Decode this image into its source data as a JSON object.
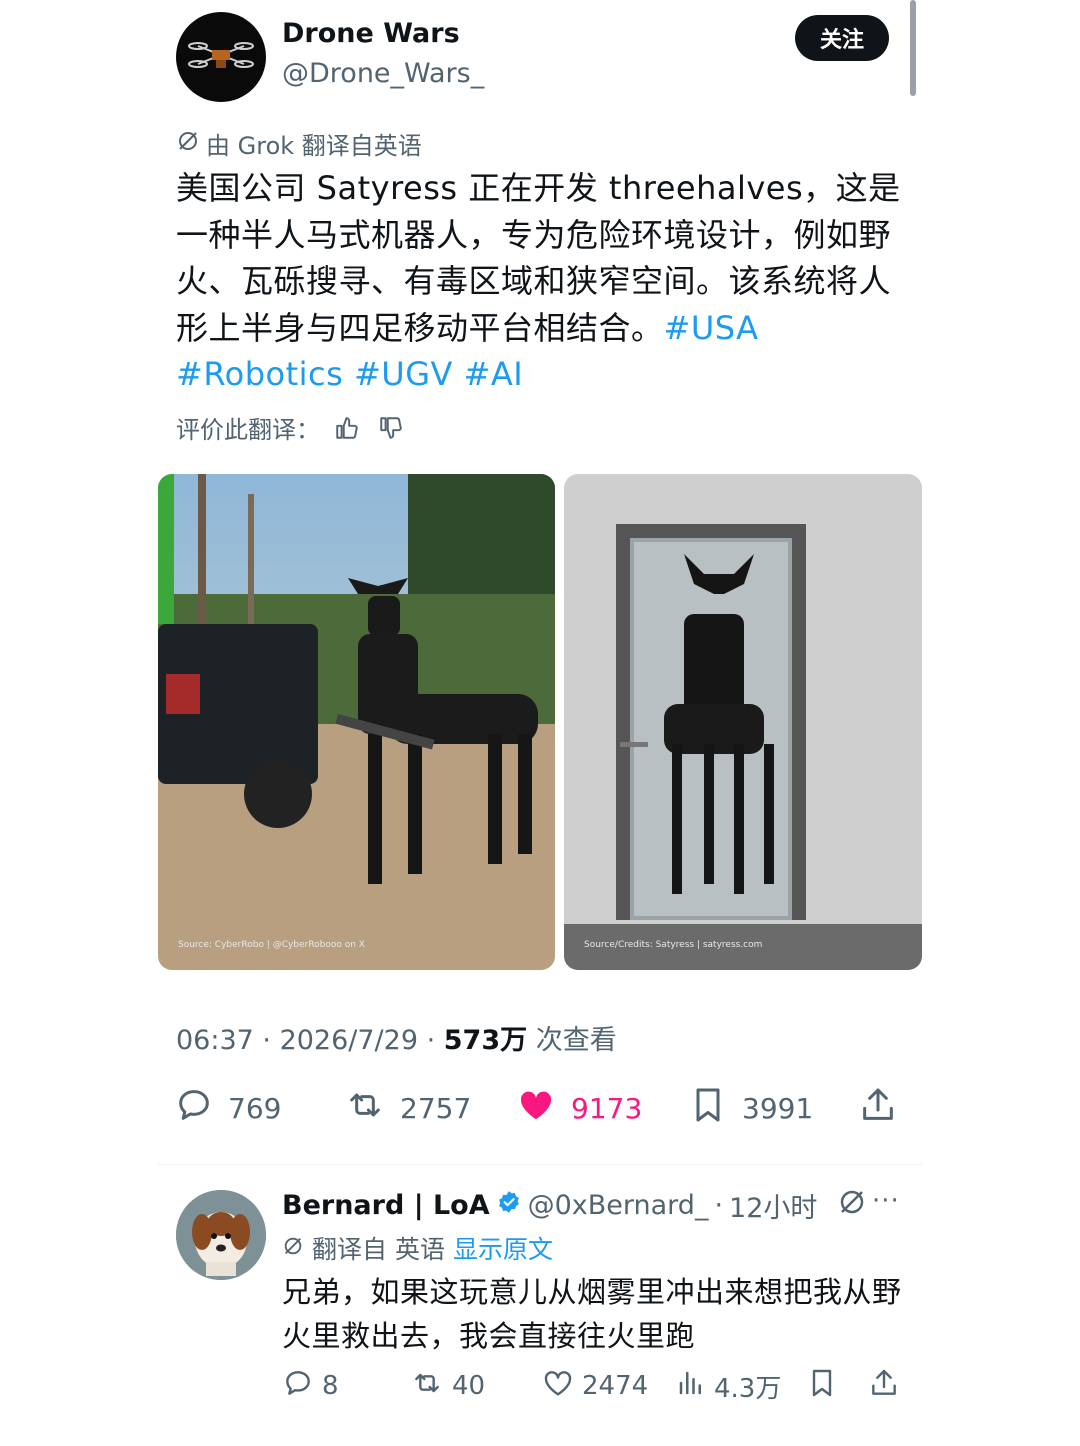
{
  "tweet": {
    "author_name": "Drone Wars",
    "author_handle": "@Drone_Wars_",
    "follow_label": "关注",
    "translation_note": "由 Grok 翻译自英语",
    "body": "美国公司 Satyress 正在开发 threehalves，这是一种半人马式机器人，专为危险环境设计，例如野火、瓦砾搜寻、有毒区域和狭窄空间。该系统将人形上半身与四足移动平台相结合。",
    "hashtags": [
      "#USA",
      "#Robotics",
      "#UGV",
      "#AI"
    ],
    "rate_label": "评价此翻译：",
    "photos": [
      {
        "caption": "Source: CyberRobo | @CyberRobooo on X"
      },
      {
        "caption": "Source/Credits: Satyress | satyress.com"
      }
    ],
    "time": "06:37",
    "date": "2026/7/29",
    "views_count": "573万",
    "views_label": "次查看",
    "stats": {
      "replies": "769",
      "retweets": "2757",
      "likes": "9173",
      "bookmarks": "3991"
    },
    "colors": {
      "accent": "#1d9bf0",
      "like": "#f91880",
      "muted": "#536471"
    }
  },
  "reply": {
    "author_name": "Bernard | LoA",
    "author_handle": "@0xBernard_",
    "time": "12小时",
    "translation_prefix": "翻译自 英语",
    "show_original": "显示原文",
    "body": "兄弟，如果这玩意儿从烟雾里冲出来想把我从野火里救出去，我会直接往火里跑",
    "stats": {
      "replies": "8",
      "retweets": "40",
      "likes": "2474",
      "views": "4.3万"
    },
    "more": "···"
  },
  "icons": [
    "grok-translate-icon",
    "thumbs-up-icon",
    "thumbs-down-icon",
    "reply-icon",
    "retweet-icon",
    "heart-icon",
    "bookmark-icon",
    "share-icon",
    "views-icon",
    "verified-badge-icon",
    "more-icon"
  ]
}
